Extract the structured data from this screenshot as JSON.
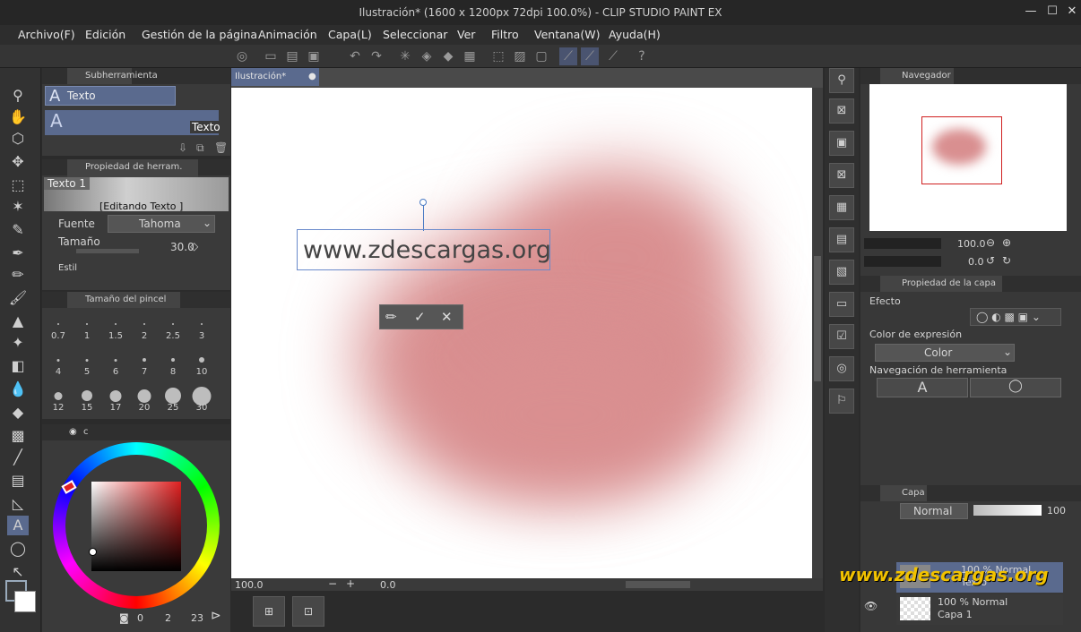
{
  "window": {
    "title": "Ilustración* (1600 x 1200px 72dpi 100.0%) - CLIP STUDIO PAINT EX",
    "min": "—",
    "max": "☐",
    "close": "✕"
  },
  "menu": [
    "Archivo(F)",
    "Edición",
    "Gestión de la página",
    "Animación",
    "Capa(L)",
    "Seleccionar",
    "Ver",
    "Filtro",
    "Ventana(W)",
    "Ayuda(H)"
  ],
  "subtool": {
    "header": "Subherramienta",
    "item": "Texto",
    "preview_label": "Texto"
  },
  "toolprop": {
    "header": "Propiedad de herram. [Texto]",
    "preview_tag": "Texto 1",
    "preview_caption": "[Editando Texto ]",
    "font_label": "Fuente",
    "font_value": "Tahoma",
    "size_label": "Tamaño",
    "size_value": "30.0",
    "style_label": "Estil"
  },
  "brushsize": {
    "header": "Tamaño del pincel",
    "sizes": [
      "0.7",
      "1",
      "1.5",
      "2",
      "2.5",
      "3",
      "4",
      "5",
      "6",
      "7",
      "8",
      "10",
      "12",
      "15",
      "17",
      "20",
      "25",
      "30"
    ]
  },
  "colorwheel": {
    "tab": "c",
    "footer_a": "0",
    "footer_b": "2",
    "footer_c": "23"
  },
  "canvas": {
    "tab": "Ilustración*",
    "text": "www.zdescargas.org",
    "zoom": "100.0",
    "angle": "0.0"
  },
  "navigator": {
    "header": "Navegador",
    "zoom_value": "100.0",
    "angle_value": "0.0"
  },
  "layerprop": {
    "header": "Propiedad de la capa",
    "effect_label": "Efecto",
    "expr_label": "Color de expresión",
    "expr_value": "Color",
    "nav_label": "Navegación de herramienta"
  },
  "layers": {
    "header": "Capa",
    "blend": "Normal",
    "opacity": "100",
    "rows": [
      {
        "meta": "100 % Normal",
        "name": "Texto"
      },
      {
        "meta": "100 % Normal",
        "name": "Capa 1"
      }
    ]
  },
  "watermark": "www.zdescargas.org",
  "colors": {
    "blob": "#d98f90",
    "accent": "#5a6a8e",
    "watermark": "#f2c200"
  }
}
